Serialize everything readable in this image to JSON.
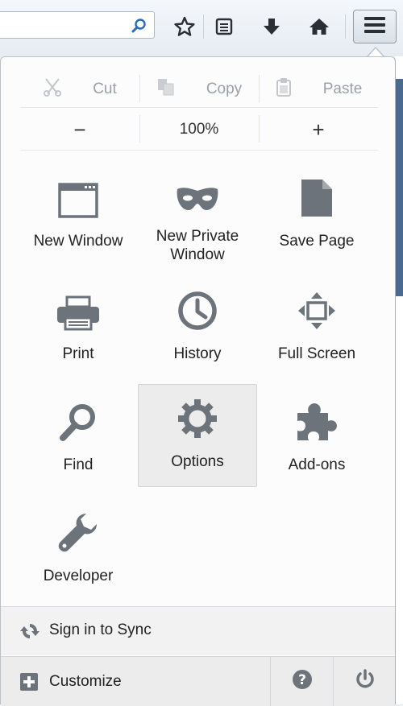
{
  "toolbar": {
    "search_value": "",
    "icons": [
      "search-icon",
      "bookmark-star-icon",
      "reading-list-icon",
      "download-icon",
      "home-icon",
      "menu-icon"
    ]
  },
  "edit": {
    "cut": "Cut",
    "copy": "Copy",
    "paste": "Paste"
  },
  "zoom": {
    "out": "−",
    "level": "100%",
    "in": "+"
  },
  "grid": [
    {
      "label": "New Window",
      "icon": "new-window-icon"
    },
    {
      "label": "New Private\nWindow",
      "icon": "private-mask-icon"
    },
    {
      "label": "Save Page",
      "icon": "save-page-icon"
    },
    {
      "label": "Print",
      "icon": "printer-icon"
    },
    {
      "label": "History",
      "icon": "clock-icon"
    },
    {
      "label": "Full Screen",
      "icon": "fullscreen-icon"
    },
    {
      "label": "Find",
      "icon": "magnifier-icon"
    },
    {
      "label": "Options",
      "icon": "gear-icon",
      "active": true
    },
    {
      "label": "Add-ons",
      "icon": "puzzle-icon"
    },
    {
      "label": "Developer",
      "icon": "wrench-icon"
    }
  ],
  "sync": {
    "label": "Sign in to Sync"
  },
  "footer": {
    "customize": "Customize"
  },
  "colors": {
    "icon_gray": "#6d737b",
    "active_bg": "#ececec"
  }
}
